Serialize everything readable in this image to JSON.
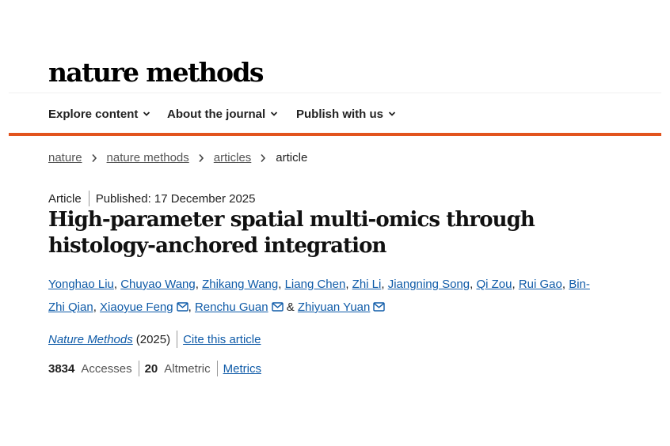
{
  "header": {
    "logo_text": "nature methods"
  },
  "nav": {
    "items": [
      {
        "label": "Explore content"
      },
      {
        "label": "About the journal"
      },
      {
        "label": "Publish with us"
      }
    ]
  },
  "breadcrumb": {
    "items": [
      "nature",
      "nature methods",
      "articles"
    ],
    "current": "article"
  },
  "article": {
    "type": "Article",
    "published": "Published: 17 December 2025",
    "title": "High-parameter spatial multi-omics through histology-anchored integration",
    "authors": [
      {
        "name": "Yonghao Liu",
        "sep": ", "
      },
      {
        "name": "Chuyao Wang",
        "sep": ", "
      },
      {
        "name": "Zhikang Wang",
        "sep": ", "
      },
      {
        "name": "Liang Chen",
        "sep": ", "
      },
      {
        "name": "Zhi Li",
        "sep": ", "
      },
      {
        "name": "Jiangning Song",
        "sep": ", "
      },
      {
        "name": "Qi Zou",
        "sep": ", "
      },
      {
        "name": "Rui Gao",
        "sep": ", "
      },
      {
        "name": "Bin-Zhi Qian",
        "sep": ", "
      },
      {
        "name": "Xiaoyue Feng",
        "sep": ", "
      },
      {
        "name": "Renchu Guan",
        "sep": " & "
      },
      {
        "name": "Zhiyuan Yuan",
        "sep": ""
      }
    ],
    "journal": "Nature Methods",
    "year": "(2025)",
    "cite_label": "Cite this article"
  },
  "metrics": {
    "accesses_value": "3834",
    "accesses_label": "Accesses",
    "altmetric_value": "20",
    "altmetric_label": "Altmetric",
    "metrics_link": "Metrics"
  },
  "colors": {
    "accent_bar": "#e2541e",
    "link": "#0f5ba8"
  }
}
